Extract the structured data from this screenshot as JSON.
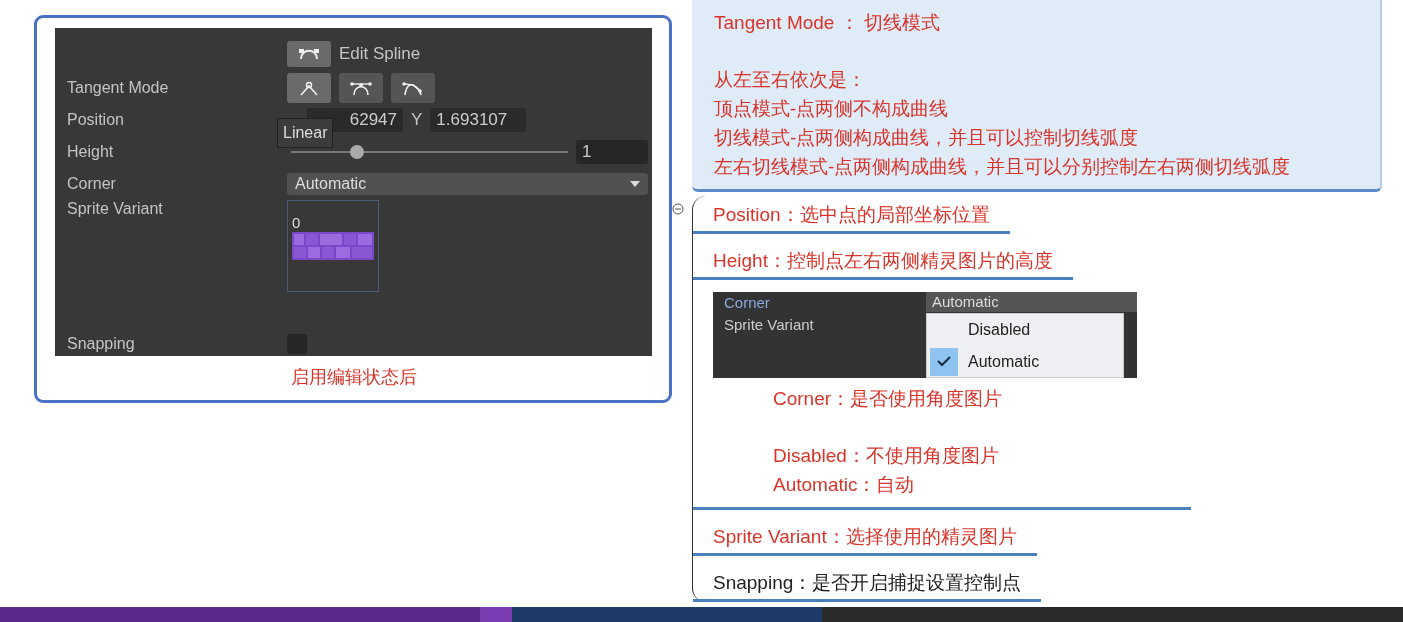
{
  "inspector_card": {
    "edit_button": {
      "label": "Edit Spline"
    },
    "tangent_mode": {
      "label": "Tangent Mode",
      "buttons": [
        {
          "kind": "linear",
          "selected": true
        },
        {
          "kind": "continuous",
          "selected": false
        },
        {
          "kind": "broken",
          "selected": false
        }
      ]
    },
    "position": {
      "label": "Position",
      "x_value": "62947",
      "y_label": "Y",
      "y_value": "1.693107"
    },
    "tooltip": "Linear",
    "height": {
      "label": "Height",
      "level": 0.24,
      "value": "1"
    },
    "corner": {
      "label": "Corner",
      "value": "Automatic"
    },
    "sprite_variant": {
      "label": "Sprite Variant",
      "index": "0"
    },
    "snapping": {
      "label": "Snapping",
      "checked": false
    },
    "caption": "启用编辑状态后"
  },
  "notes": [
    {
      "kind": "highlight",
      "color": "#d9342b",
      "lines": [
        "Tangent Mode ： 切线模式",
        "从左至右依次是：",
        "顶点模式-点两侧不构成曲线",
        "切线模式-点两侧构成曲线，并且可以控制切线弧度",
        "左右切线模式-点两侧构成曲线，并且可以分别控制左右两侧切线弧度"
      ]
    },
    {
      "kind": "plain",
      "color": "#d9342b",
      "lines": [
        "Position：选中点的局部坐标位置"
      ]
    },
    {
      "kind": "plain",
      "color": "#d9342b",
      "lines": [
        "Height：控制点左右两侧精灵图片的高度"
      ]
    },
    {
      "kind": "dropdown_shot",
      "color": "#d9342b",
      "labels": [
        "Corner",
        "Sprite Variant"
      ],
      "dropdown_value": "Automatic",
      "options": [
        {
          "label": "Disabled",
          "selected": false
        },
        {
          "label": "Automatic",
          "selected": true
        }
      ],
      "lines": [
        "Corner：是否使用角度图片",
        "Disabled：不使用角度图片",
        "Automatic：自动"
      ]
    },
    {
      "kind": "plain",
      "color": "#d9342b",
      "lines": [
        "Sprite Variant：选择使用的精灵图片"
      ]
    },
    {
      "kind": "plain",
      "color": "#222222",
      "lines": [
        "Snapping：是否开启捕捉设置控制点"
      ]
    }
  ]
}
